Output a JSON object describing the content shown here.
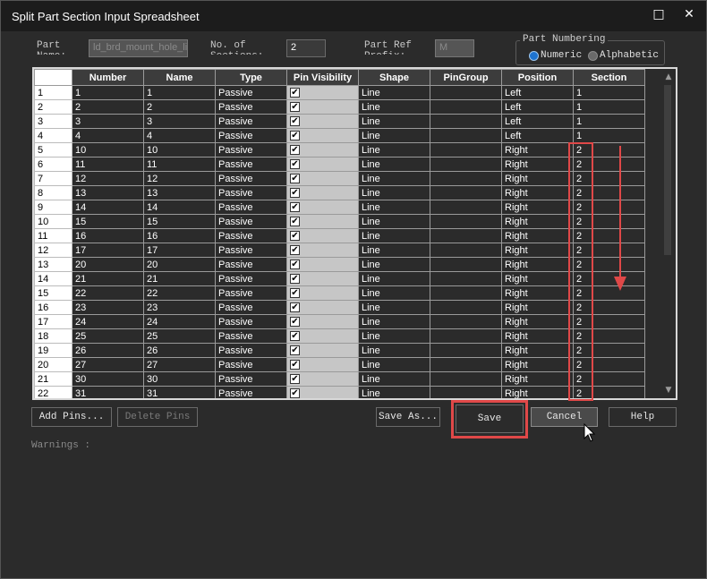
{
  "window": {
    "title": "Split Part Section Input Spreadsheet",
    "maximize_icon": "□",
    "close_icon": "✕"
  },
  "form": {
    "part_name_label": "Part\nName:",
    "part_name_value": "ld_brd_mount_hole_li",
    "sections_label": "No. of\nSections:",
    "sections_value": "2",
    "refprefix_label": "Part Ref\nPrefix:",
    "refprefix_value": "M",
    "numbering_title": "Part Numbering",
    "numeric_label": "Numeric",
    "alphabetic_label": "Alphabetic"
  },
  "table": {
    "columns": [
      "",
      "Number",
      "Name",
      "Type",
      "Pin Visibility",
      "Shape",
      "PinGroup",
      "Position",
      "Section"
    ],
    "rows": [
      {
        "id": "1",
        "number": "1",
        "name": "1",
        "type": "Passive",
        "shape": "Line",
        "pingroup": "",
        "position": "Left",
        "section": "1"
      },
      {
        "id": "2",
        "number": "2",
        "name": "2",
        "type": "Passive",
        "shape": "Line",
        "pingroup": "",
        "position": "Left",
        "section": "1"
      },
      {
        "id": "3",
        "number": "3",
        "name": "3",
        "type": "Passive",
        "shape": "Line",
        "pingroup": "",
        "position": "Left",
        "section": "1"
      },
      {
        "id": "4",
        "number": "4",
        "name": "4",
        "type": "Passive",
        "shape": "Line",
        "pingroup": "",
        "position": "Left",
        "section": "1"
      },
      {
        "id": "5",
        "number": "10",
        "name": "10",
        "type": "Passive",
        "shape": "Line",
        "pingroup": "",
        "position": "Right",
        "section": "2"
      },
      {
        "id": "6",
        "number": "11",
        "name": "11",
        "type": "Passive",
        "shape": "Line",
        "pingroup": "",
        "position": "Right",
        "section": "2"
      },
      {
        "id": "7",
        "number": "12",
        "name": "12",
        "type": "Passive",
        "shape": "Line",
        "pingroup": "",
        "position": "Right",
        "section": "2"
      },
      {
        "id": "8",
        "number": "13",
        "name": "13",
        "type": "Passive",
        "shape": "Line",
        "pingroup": "",
        "position": "Right",
        "section": "2"
      },
      {
        "id": "9",
        "number": "14",
        "name": "14",
        "type": "Passive",
        "shape": "Line",
        "pingroup": "",
        "position": "Right",
        "section": "2"
      },
      {
        "id": "10",
        "number": "15",
        "name": "15",
        "type": "Passive",
        "shape": "Line",
        "pingroup": "",
        "position": "Right",
        "section": "2"
      },
      {
        "id": "11",
        "number": "16",
        "name": "16",
        "type": "Passive",
        "shape": "Line",
        "pingroup": "",
        "position": "Right",
        "section": "2"
      },
      {
        "id": "12",
        "number": "17",
        "name": "17",
        "type": "Passive",
        "shape": "Line",
        "pingroup": "",
        "position": "Right",
        "section": "2"
      },
      {
        "id": "13",
        "number": "20",
        "name": "20",
        "type": "Passive",
        "shape": "Line",
        "pingroup": "",
        "position": "Right",
        "section": "2"
      },
      {
        "id": "14",
        "number": "21",
        "name": "21",
        "type": "Passive",
        "shape": "Line",
        "pingroup": "",
        "position": "Right",
        "section": "2"
      },
      {
        "id": "15",
        "number": "22",
        "name": "22",
        "type": "Passive",
        "shape": "Line",
        "pingroup": "",
        "position": "Right",
        "section": "2"
      },
      {
        "id": "16",
        "number": "23",
        "name": "23",
        "type": "Passive",
        "shape": "Line",
        "pingroup": "",
        "position": "Right",
        "section": "2"
      },
      {
        "id": "17",
        "number": "24",
        "name": "24",
        "type": "Passive",
        "shape": "Line",
        "pingroup": "",
        "position": "Right",
        "section": "2"
      },
      {
        "id": "18",
        "number": "25",
        "name": "25",
        "type": "Passive",
        "shape": "Line",
        "pingroup": "",
        "position": "Right",
        "section": "2"
      },
      {
        "id": "19",
        "number": "26",
        "name": "26",
        "type": "Passive",
        "shape": "Line",
        "pingroup": "",
        "position": "Right",
        "section": "2"
      },
      {
        "id": "20",
        "number": "27",
        "name": "27",
        "type": "Passive",
        "shape": "Line",
        "pingroup": "",
        "position": "Right",
        "section": "2"
      },
      {
        "id": "21",
        "number": "30",
        "name": "30",
        "type": "Passive",
        "shape": "Line",
        "pingroup": "",
        "position": "Right",
        "section": "2"
      },
      {
        "id": "22",
        "number": "31",
        "name": "31",
        "type": "Passive",
        "shape": "Line",
        "pingroup": "",
        "position": "Right",
        "section": "2"
      }
    ],
    "checkmark": "✔"
  },
  "buttons": {
    "add_pins": "Add Pins...",
    "delete_pins": "Delete Pins",
    "save_as": "Save As...",
    "save": "Save",
    "cancel": "Cancel",
    "help": "Help"
  },
  "warnings_label": "Warnings :",
  "colors": {
    "highlight": "#e04848",
    "accent": "#1e74d0"
  }
}
